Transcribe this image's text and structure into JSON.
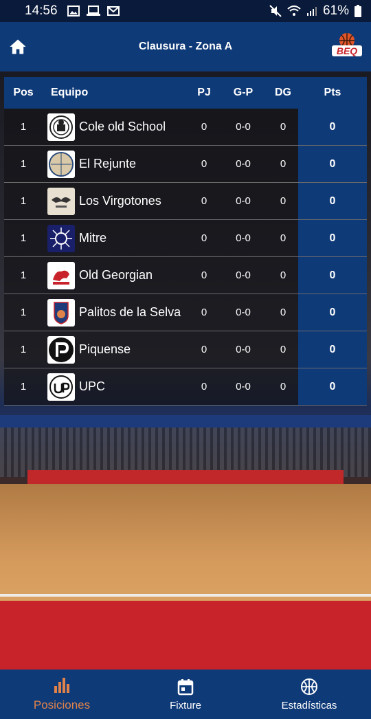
{
  "status_bar": {
    "time": "14:56",
    "battery": "61%"
  },
  "app_bar": {
    "title": "Clausura - Zona A",
    "logo_text": "BEQ"
  },
  "table": {
    "headers": {
      "pos": "Pos",
      "team": "Equipo",
      "pj": "PJ",
      "gp": "G-P",
      "dg": "DG",
      "pts": "Pts"
    },
    "rows": [
      {
        "pos": "1",
        "team": "Cole old School",
        "logo": "cole-old-school-logo",
        "pj": "0",
        "gp": "0-0",
        "dg": "0",
        "pts": "0"
      },
      {
        "pos": "1",
        "team": "El Rejunte",
        "logo": "el-rejunte-logo",
        "pj": "0",
        "gp": "0-0",
        "dg": "0",
        "pts": "0"
      },
      {
        "pos": "1",
        "team": "Los Virgotones",
        "logo": "los-virgotones-logo",
        "pj": "0",
        "gp": "0-0",
        "dg": "0",
        "pts": "0"
      },
      {
        "pos": "1",
        "team": "Mitre",
        "logo": "mitre-logo",
        "pj": "0",
        "gp": "0-0",
        "dg": "0",
        "pts": "0"
      },
      {
        "pos": "1",
        "team": "Old Georgian",
        "logo": "old-georgian-logo",
        "pj": "0",
        "gp": "0-0",
        "dg": "0",
        "pts": "0"
      },
      {
        "pos": "1",
        "team": "Palitos de la Selva",
        "logo": "palitos-de-la-selva-logo",
        "pj": "0",
        "gp": "0-0",
        "dg": "0",
        "pts": "0"
      },
      {
        "pos": "1",
        "team": "Piquense",
        "logo": "piquense-logo",
        "pj": "0",
        "gp": "0-0",
        "dg": "0",
        "pts": "0"
      },
      {
        "pos": "1",
        "team": "UPC",
        "logo": "upc-logo",
        "pj": "0",
        "gp": "0-0",
        "dg": "0",
        "pts": "0"
      }
    ]
  },
  "bottom_nav": {
    "items": [
      {
        "label": "Posiciones",
        "icon": "bar-chart-icon",
        "active": true
      },
      {
        "label": "Fixture",
        "icon": "calendar-icon",
        "active": false
      },
      {
        "label": "Estadísticas",
        "icon": "basketball-icon",
        "active": false
      }
    ]
  },
  "colors": {
    "primary": "#0f3a78",
    "accent": "#e0834a",
    "row_bg": "#141418"
  }
}
